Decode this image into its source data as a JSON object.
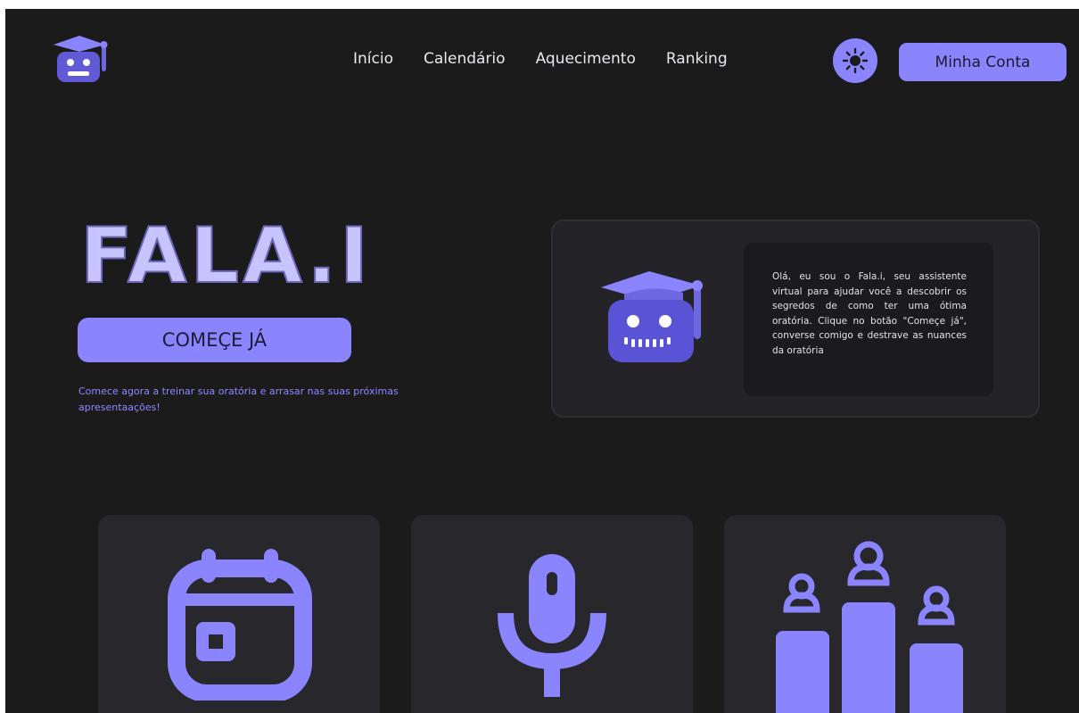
{
  "header": {
    "logo_icon": "robot-graduate-icon",
    "nav": [
      "Início",
      "Calendário",
      "Aquecimento",
      "Ranking"
    ],
    "theme_toggle_icon": "sun-icon",
    "account_button": "Minha Conta"
  },
  "hero": {
    "brand": "FALA.I",
    "cta_label": "COMEÇE JÁ",
    "tagline": "Comece agora a treinar sua oratória e arrasar nas suas próximas apresentaações!"
  },
  "intro": {
    "robot_icon": "robot-graduate-icon",
    "message": "Olá, eu sou o Fala.i, seu assistente virtual para ajudar você a descobrir os segredos de como ter uma ótima oratória. Clique no botão \"Começe já\", converse comigo e destrave as nuances da oratória"
  },
  "features": [
    {
      "icon": "calendar-icon"
    },
    {
      "icon": "microphone-icon"
    },
    {
      "icon": "ranking-podium-icon"
    }
  ],
  "colors": {
    "background": "#1b1b1c",
    "accent": "#8a84ff",
    "brand_text": "#c7c4ff",
    "card": "#28282c"
  }
}
